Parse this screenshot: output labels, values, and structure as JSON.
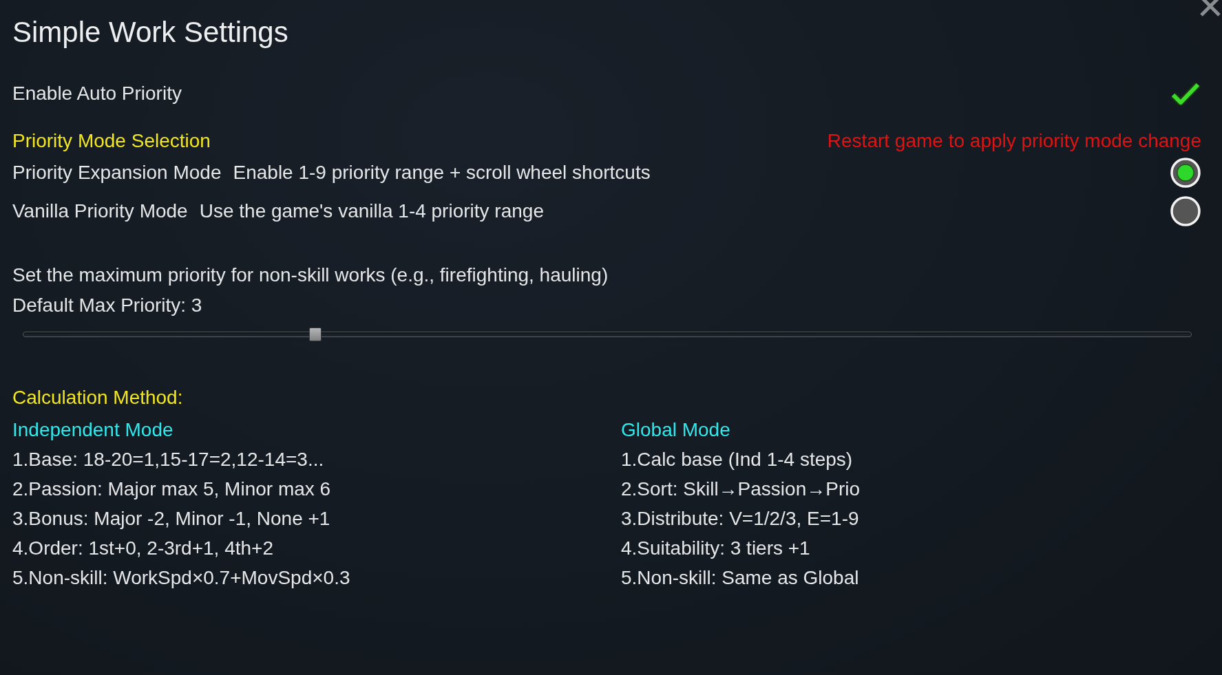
{
  "window": {
    "title": "Simple Work Settings"
  },
  "auto_priority": {
    "label": "Enable Auto Priority",
    "checked": true
  },
  "priority_mode": {
    "heading": "Priority Mode Selection",
    "notice": "Restart game to apply priority mode change",
    "options": [
      {
        "name": "Priority Expansion Mode",
        "description": "Enable 1-9 priority range + scroll wheel shortcuts",
        "selected": true
      },
      {
        "name": "Vanilla Priority Mode",
        "description": "Use the game's vanilla 1-4 priority range",
        "selected": false
      }
    ]
  },
  "max_priority": {
    "description": "Set the maximum priority for non-skill works (e.g., firefighting, hauling)",
    "label": "Default Max Priority: 3",
    "level": 0.25
  },
  "calculation": {
    "heading": "Calculation Method:",
    "modes": [
      {
        "title": "Independent Mode",
        "steps": [
          "1.Base: 18-20=1,15-17=2,12-14=3...",
          "2.Passion: Major max 5, Minor max 6",
          "3.Bonus: Major -2, Minor -1, None +1",
          "4.Order: 1st+0, 2-3rd+1, 4th+2",
          "5.Non-skill: WorkSpd×0.7+MovSpd×0.3"
        ]
      },
      {
        "title": "Global Mode",
        "steps": [
          "1.Calc base (Ind 1-4 steps)",
          "2.Sort: Skill→Passion→Prio",
          "3.Distribute: V=1/2/3, E=1-9",
          "4.Suitability: 3 tiers +1",
          "5.Non-skill: Same as Global"
        ]
      }
    ]
  }
}
